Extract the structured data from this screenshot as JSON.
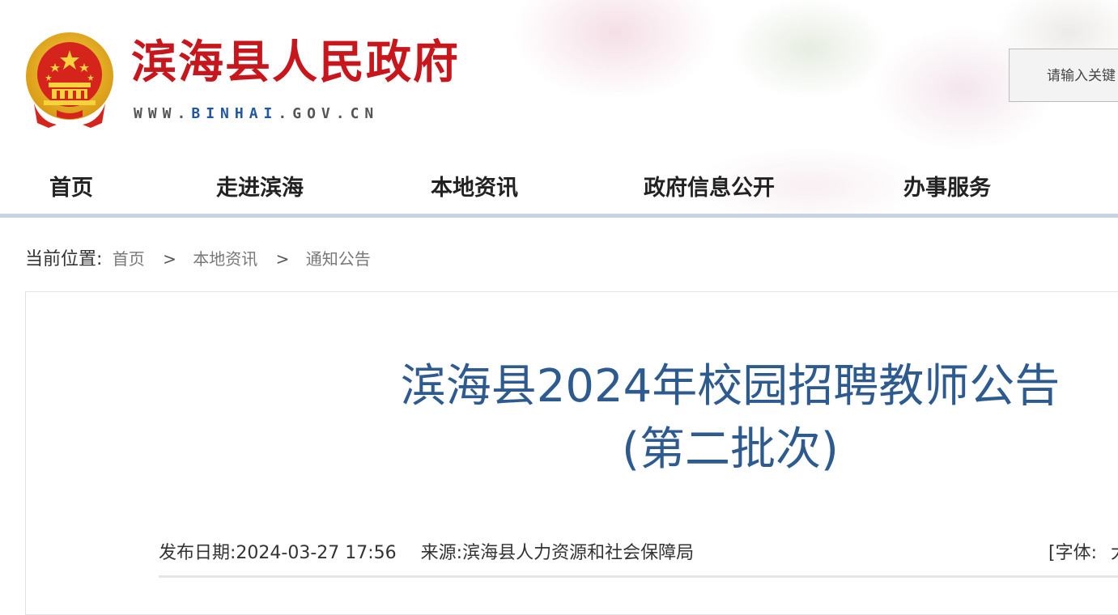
{
  "header": {
    "site_title": "滨海县人民政府",
    "site_url_pre": "WWW.",
    "site_url_mid": "BINHAI",
    "site_url_post": ".GOV.CN",
    "search_placeholder": "请输入关键"
  },
  "nav": {
    "items": [
      {
        "label": "首页"
      },
      {
        "label": "走进滨海"
      },
      {
        "label": "本地资讯"
      },
      {
        "label": "政府信息公开"
      },
      {
        "label": "办事服务"
      }
    ]
  },
  "breadcrumb": {
    "lead": "当前位置:",
    "items": [
      "首页",
      "本地资讯",
      "通知公告"
    ],
    "separator": ">"
  },
  "article": {
    "title_line1": "滨海县2024年校园招聘教师公告",
    "title_line2": "(第二批次)",
    "publish_label": "发布日期:",
    "publish_date": "2024-03-27 17:56",
    "source_label": "来源:",
    "source": "滨海县人力资源和社会保障局",
    "font_label": "[字体:",
    "font_size_option": "大"
  },
  "colors": {
    "brand_red": "#c8161d",
    "title_blue": "#2e5b8f",
    "nav_line": "#c6d3e2"
  }
}
